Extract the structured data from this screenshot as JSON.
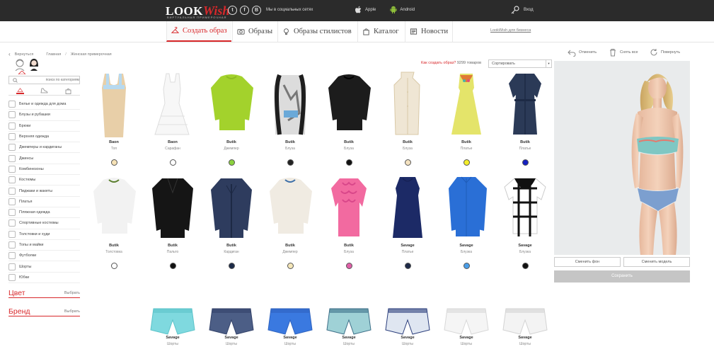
{
  "header": {
    "logo_look": "LOOK",
    "logo_wish": "Wish",
    "logo_tagline": "ВИРТУАЛЬНАЯ ПРИМЕРОЧНАЯ",
    "social_label": "Мы в социальных сетях",
    "social_icons": [
      "twitter-icon",
      "facebook-icon",
      "vk-icon"
    ],
    "app_apple": "Apple",
    "app_android": "Android",
    "login": "Вход"
  },
  "nav": {
    "items": [
      {
        "label": "Создать образ",
        "icon": "hanger-icon"
      },
      {
        "label": "Образы",
        "icon": "camera-icon"
      },
      {
        "label": "Образы стилистов",
        "icon": "bulb-icon"
      },
      {
        "label": "Каталог",
        "icon": "bag-icon"
      },
      {
        "label": "Новости",
        "icon": "news-icon"
      }
    ],
    "business_link": "LookWish для бизнеса"
  },
  "breadcrumb": {
    "back": "Вернуться",
    "home": "Главная",
    "current": "Женская примерочная"
  },
  "sidebar": {
    "search_placeholder": "поиск по категориям",
    "categories": [
      "Белье и одежда для дома",
      "Блузы и рубашки",
      "Брюки",
      "Верхняя одежда",
      "Джемперы и кардиганы",
      "Джинсы",
      "Комбинезоны",
      "Костюмы",
      "Пиджаки и жакеты",
      "Платья",
      "Пляжная одежда",
      "Спортивные костюмы",
      "Толстовки и худи",
      "Топы и майки",
      "Футболки",
      "Шорты",
      "Юбки"
    ],
    "filters": [
      {
        "title": "Цвет",
        "choose": "Выбрать"
      },
      {
        "title": "Бренд",
        "choose": "Выбрать"
      }
    ]
  },
  "products_header": {
    "howto": "Как создать образ?",
    "count": "9299 товаров",
    "sort_placeholder": "Сортировать"
  },
  "products": [
    {
      "brand": "Baon",
      "type": "Топ",
      "color": "#f6e2b6",
      "kind": "top-tank",
      "main": "#e8cfa8",
      "accent": "#b7d9ef"
    },
    {
      "brand": "Baon",
      "type": "Сарафан",
      "color": "#ffffff",
      "kind": "dress-flare",
      "main": "#f7f7f7",
      "accent": "#e0e0e0"
    },
    {
      "brand": "Butik",
      "type": "Джемпер",
      "color": "#8bd13e",
      "kind": "sweater",
      "main": "#a3d22c",
      "accent": "#8dbb22"
    },
    {
      "brand": "Butik",
      "type": "Блуза",
      "color": "#222222",
      "kind": "blouse-print",
      "main": "#dcdcdc",
      "accent": "#1e1e1e"
    },
    {
      "brand": "Butik",
      "type": "Блуза",
      "color": "#111111",
      "kind": "sweater",
      "main": "#1c1c1c",
      "accent": "#000000"
    },
    {
      "brand": "Butik",
      "type": "Блуза",
      "color": "#f4e2c0",
      "kind": "blouse-halter",
      "main": "#efe6d4",
      "accent": "#d9c9a7"
    },
    {
      "brand": "Butik",
      "type": "Платье",
      "color": "#f4ee2a",
      "kind": "dress-a",
      "main": "#e4e46a",
      "accent": "#e07a35"
    },
    {
      "brand": "Butik",
      "type": "Платье",
      "color": "#1620c0",
      "kind": "dress-shirt",
      "main": "#2b3a57",
      "accent": "#1d2a45"
    },
    {
      "brand": "Butik",
      "type": "Толстовка",
      "color": "#ffffff",
      "kind": "sweater",
      "main": "#f2f2f2",
      "accent": "#5b7f2f"
    },
    {
      "brand": "Butik",
      "type": "Пальто",
      "color": "#111111",
      "kind": "coat",
      "main": "#151515",
      "accent": "#000000"
    },
    {
      "brand": "Butik",
      "type": "Кардиган",
      "color": "#1c2a48",
      "kind": "cardigan",
      "main": "#2e3c5e",
      "accent": "#1d2944"
    },
    {
      "brand": "Butik",
      "type": "Джемпер",
      "color": "#f4e6b8",
      "kind": "sweater",
      "main": "#f0ebe2",
      "accent": "#3d6fa8"
    },
    {
      "brand": "Butik",
      "type": "Блуза",
      "color": "#e060a8",
      "kind": "blouse-ruffle",
      "main": "#f26aa0",
      "accent": "#d9478a"
    },
    {
      "brand": "Savage",
      "type": "Платье",
      "color": "#1e2a48",
      "kind": "dress-straight",
      "main": "#1c2a66",
      "accent": "#141f50"
    },
    {
      "brand": "Savage",
      "type": "Блузка",
      "color": "#4a9ee8",
      "kind": "shirt",
      "main": "#2a6fd6",
      "accent": "#1f5cb8"
    },
    {
      "brand": "Savage",
      "type": "Блузка",
      "color": "#111111",
      "kind": "top-check",
      "main": "#ffffff",
      "accent": "#111111"
    },
    {
      "brand": "Savage",
      "type": "Шорты",
      "color": "",
      "kind": "shorts",
      "main": "#7fd9df",
      "accent": "#5bc3c9"
    },
    {
      "brand": "Savage",
      "type": "Шорты",
      "color": "",
      "kind": "shorts",
      "main": "#4c5e86",
      "accent": "#34436a"
    },
    {
      "brand": "Savage",
      "type": "Шорты",
      "color": "",
      "kind": "shorts",
      "main": "#3a79e0",
      "accent": "#2f63bf"
    },
    {
      "brand": "Savage",
      "type": "Шорты",
      "color": "",
      "kind": "shorts",
      "main": "#9fd1d6",
      "accent": "#3d6f88"
    },
    {
      "brand": "Savage",
      "type": "Шорты",
      "color": "",
      "kind": "shorts",
      "main": "#dfe6f1",
      "accent": "#2b3e7c"
    },
    {
      "brand": "Savage",
      "type": "Шорты",
      "color": "",
      "kind": "shorts",
      "main": "#f5f5f5",
      "accent": "#d8d8d8"
    },
    {
      "brand": "Savage",
      "type": "Шорты",
      "color": "",
      "kind": "shorts",
      "main": "#f3f3f3",
      "accent": "#d3d3d3"
    }
  ],
  "right_panel": {
    "undo": "Отменить",
    "remove_all": "Снять все",
    "rotate": "Повернуть",
    "change_bg": "Сменить фон",
    "change_model": "Сменить модель",
    "save": "Сохранить"
  },
  "colors": {
    "accent": "#d8282b",
    "topbar": "#2b2b2b"
  }
}
